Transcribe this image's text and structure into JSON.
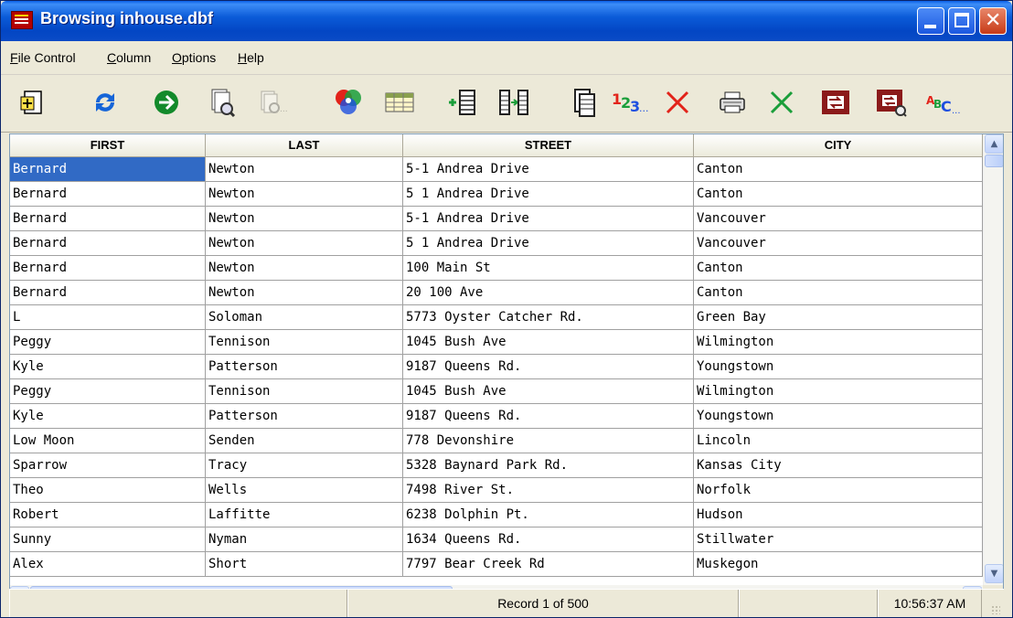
{
  "window": {
    "title": "Browsing inhouse.dbf"
  },
  "menu": [
    {
      "label": "File Control",
      "accel_index": 0
    },
    {
      "label": "Column",
      "accel_index": 0
    },
    {
      "label": "Options",
      "accel_index": 0
    },
    {
      "label": "Help",
      "accel_index": 0
    }
  ],
  "toolbar": {
    "tools": [
      {
        "icon": "add-record-icon"
      },
      {
        "icon": "refresh-icon"
      },
      {
        "icon": "go-icon"
      },
      {
        "icon": "find-icon"
      },
      {
        "icon": "find-next-icon",
        "disabled": true
      },
      {
        "icon": "color-icon"
      },
      {
        "icon": "browse-grid-icon"
      },
      {
        "icon": "insert-column-icon"
      },
      {
        "icon": "move-column-icon"
      },
      {
        "icon": "copy-icon"
      },
      {
        "icon": "sequence-numbers-icon"
      },
      {
        "icon": "delete-icon"
      },
      {
        "icon": "print-icon"
      },
      {
        "icon": "clear-icon"
      },
      {
        "icon": "replace-icon"
      },
      {
        "icon": "replace-search-icon"
      },
      {
        "icon": "spell-abc-icon"
      }
    ]
  },
  "grid": {
    "columns": [
      "FIRST",
      "LAST",
      "STREET",
      "CITY"
    ],
    "rows": [
      [
        "Bernard",
        "Newton",
        "5-1 Andrea Drive",
        "Canton"
      ],
      [
        "Bernard",
        "Newton",
        "5 1 Andrea Drive",
        "Canton"
      ],
      [
        "Bernard",
        "Newton",
        "5-1 Andrea Drive",
        "Vancouver"
      ],
      [
        "Bernard",
        "Newton",
        "5 1 Andrea Drive",
        "Vancouver"
      ],
      [
        "Bernard",
        "Newton",
        "100 Main St",
        "Canton"
      ],
      [
        "Bernard",
        "Newton",
        "20 100 Ave",
        "Canton"
      ],
      [
        "L",
        "Soloman",
        "5773 Oyster Catcher Rd.",
        "Green Bay"
      ],
      [
        "Peggy",
        "Tennison",
        "1045 Bush Ave",
        "Wilmington"
      ],
      [
        "Kyle",
        "Patterson",
        "9187 Queens Rd.",
        "Youngstown"
      ],
      [
        "Peggy",
        "Tennison",
        "1045 Bush Ave",
        "Wilmington"
      ],
      [
        "Kyle",
        "Patterson",
        "9187 Queens Rd.",
        "Youngstown"
      ],
      [
        "Low Moon",
        "Senden",
        "778 Devonshire",
        "Lincoln"
      ],
      [
        "Sparrow",
        "Tracy",
        "5328 Baynard Park Rd.",
        "Kansas City"
      ],
      [
        "Theo",
        "Wells",
        "7498 River St.",
        "Norfolk"
      ],
      [
        "Robert",
        "Laffitte",
        "6238 Dolphin Pt.",
        "Hudson"
      ],
      [
        "Sunny",
        "Nyman",
        "1634 Queens Rd.",
        "Stillwater"
      ],
      [
        "Alex",
        "Short",
        "7797 Bear Creek Rd",
        "Muskegon"
      ]
    ],
    "selected_row": 0,
    "selected_col": 0
  },
  "status": {
    "record": "Record 1 of 500",
    "time": "10:56:37 AM"
  },
  "colors": {
    "selection": "#316AC5",
    "titlebar": "#0A5FE8"
  }
}
